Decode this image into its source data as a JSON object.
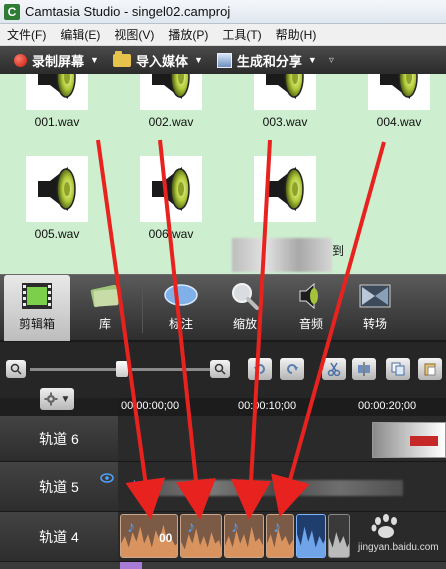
{
  "window": {
    "title": "Camtasia Studio - singel02.camproj",
    "app_icon_letter": "C"
  },
  "menu": {
    "items": [
      "文件(F)",
      "编辑(E)",
      "视图(V)",
      "播放(P)",
      "工具(T)",
      "帮助(H)"
    ]
  },
  "toolbar": {
    "record_label": "录制屏幕",
    "import_label": "导入媒体",
    "share_label": "生成和分享",
    "dropdown_glyph": "▼",
    "more_glyph": "▿"
  },
  "clipbin": {
    "clips": [
      "001.wav",
      "002.wav",
      "003.wav",
      "004.wav",
      "005.wav",
      "006.wav"
    ],
    "partial_caption": "到"
  },
  "tabs": [
    {
      "label": "剪辑箱",
      "icon": "film-icon",
      "active": true
    },
    {
      "label": "库",
      "icon": "library-icon",
      "active": false
    },
    {
      "label": "标注",
      "icon": "callout-icon",
      "active": false
    },
    {
      "label": "缩放",
      "icon": "zoom-icon",
      "active": false
    },
    {
      "label": "音频",
      "icon": "speaker-icon",
      "active": false
    },
    {
      "label": "转场",
      "icon": "transition-icon",
      "active": false
    }
  ],
  "timeline": {
    "ruler": [
      "00:00:00;00",
      "00:00:10;00",
      "00:00:20;00"
    ],
    "tracks": [
      {
        "label": "轨道 6"
      },
      {
        "label": "轨道 5"
      },
      {
        "label": "轨道 4"
      }
    ],
    "clip_label": "00",
    "watermark": "jingyan.baidu.com"
  },
  "colors": {
    "clipbin_bg": "#cdeecf",
    "annotation_red": "#e8231f",
    "audio_clip": "#7b5a46"
  }
}
